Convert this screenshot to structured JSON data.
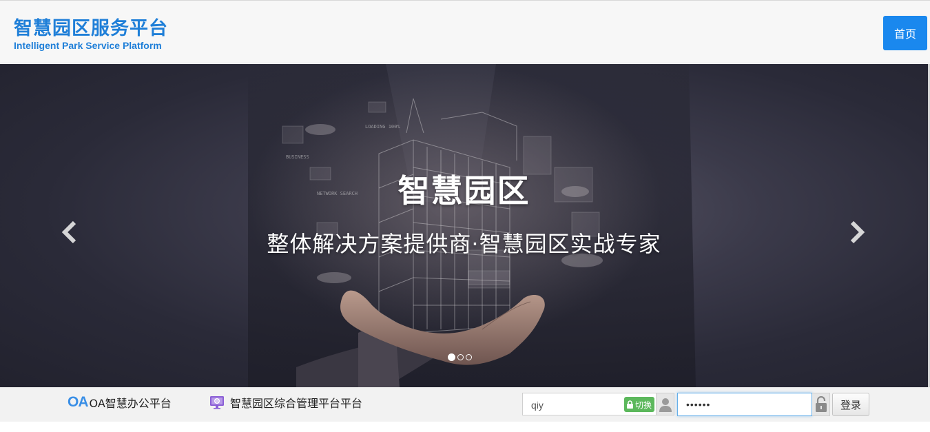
{
  "header": {
    "logo_cn": "智慧园区服务平台",
    "logo_en": "Intelligent Park Service Platform",
    "home_label": "首页"
  },
  "banner": {
    "title": "智慧园区",
    "subtitle": "整体解决方案提供商·智慧园区实战专家",
    "background_words": [
      "BUSINESS",
      "NETWORK SEARCH",
      "LOADING 100%"
    ],
    "slide_count": 3,
    "active_slide": 1
  },
  "footer": {
    "oa_logo": "OA",
    "oa_label": "OA智慧办公平台",
    "mgmt_label": "智慧园区综合管理平台平台",
    "username_value": "qiy",
    "switch_label": "切换",
    "password_value": "123456",
    "login_label": "登录"
  },
  "colors": {
    "brand_blue": "#1f7fd8",
    "home_button": "#1a88ee",
    "switch_green": "#5cb85c"
  },
  "icons": [
    "chevron-left-icon",
    "chevron-right-icon",
    "lock-icon",
    "user-icon",
    "unlock-icon",
    "monitor-gear-icon"
  ]
}
